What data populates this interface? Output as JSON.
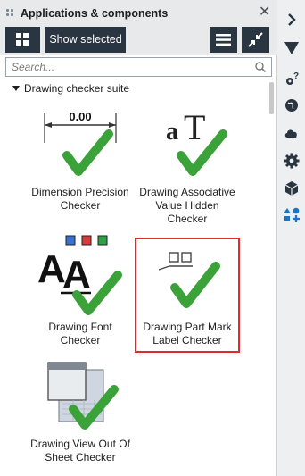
{
  "panel": {
    "title": "Applications & components",
    "toolbar": {
      "show_selected_label": "Show selected"
    },
    "search": {
      "placeholder": "Search..."
    },
    "group": {
      "label": "Drawing checker suite"
    },
    "tiles": [
      {
        "label": [
          "Dimension Precision",
          "Checker"
        ],
        "icon": "dimension-precision-icon",
        "dim_value": "0.00"
      },
      {
        "label": [
          "Drawing Associative",
          "Value Hidden",
          "Checker"
        ],
        "icon": "associative-value-icon",
        "glyph": "a T"
      },
      {
        "label": [
          "Drawing Font",
          "Checker"
        ],
        "icon": "font-checker-icon",
        "glyph": "AA"
      },
      {
        "label": [
          "Drawing Part Mark",
          "Label Checker"
        ],
        "icon": "part-mark-label-icon",
        "selected": true
      },
      {
        "label": [
          "Drawing View Out Of",
          "Sheet Checker"
        ],
        "icon": "view-out-of-sheet-icon"
      }
    ]
  },
  "rail": {
    "icons": [
      "chevron-right-icon",
      "filter-icon",
      "query-gear-icon",
      "globe-icon",
      "cloud-icon",
      "settings-gear-icon",
      "component-cube-icon",
      "applications-icon"
    ]
  },
  "colors": {
    "accent_dark": "#2a3542",
    "check_green": "#3aa238",
    "selection_red": "#e02b2b",
    "rail_active_blue": "#1a73c9"
  }
}
